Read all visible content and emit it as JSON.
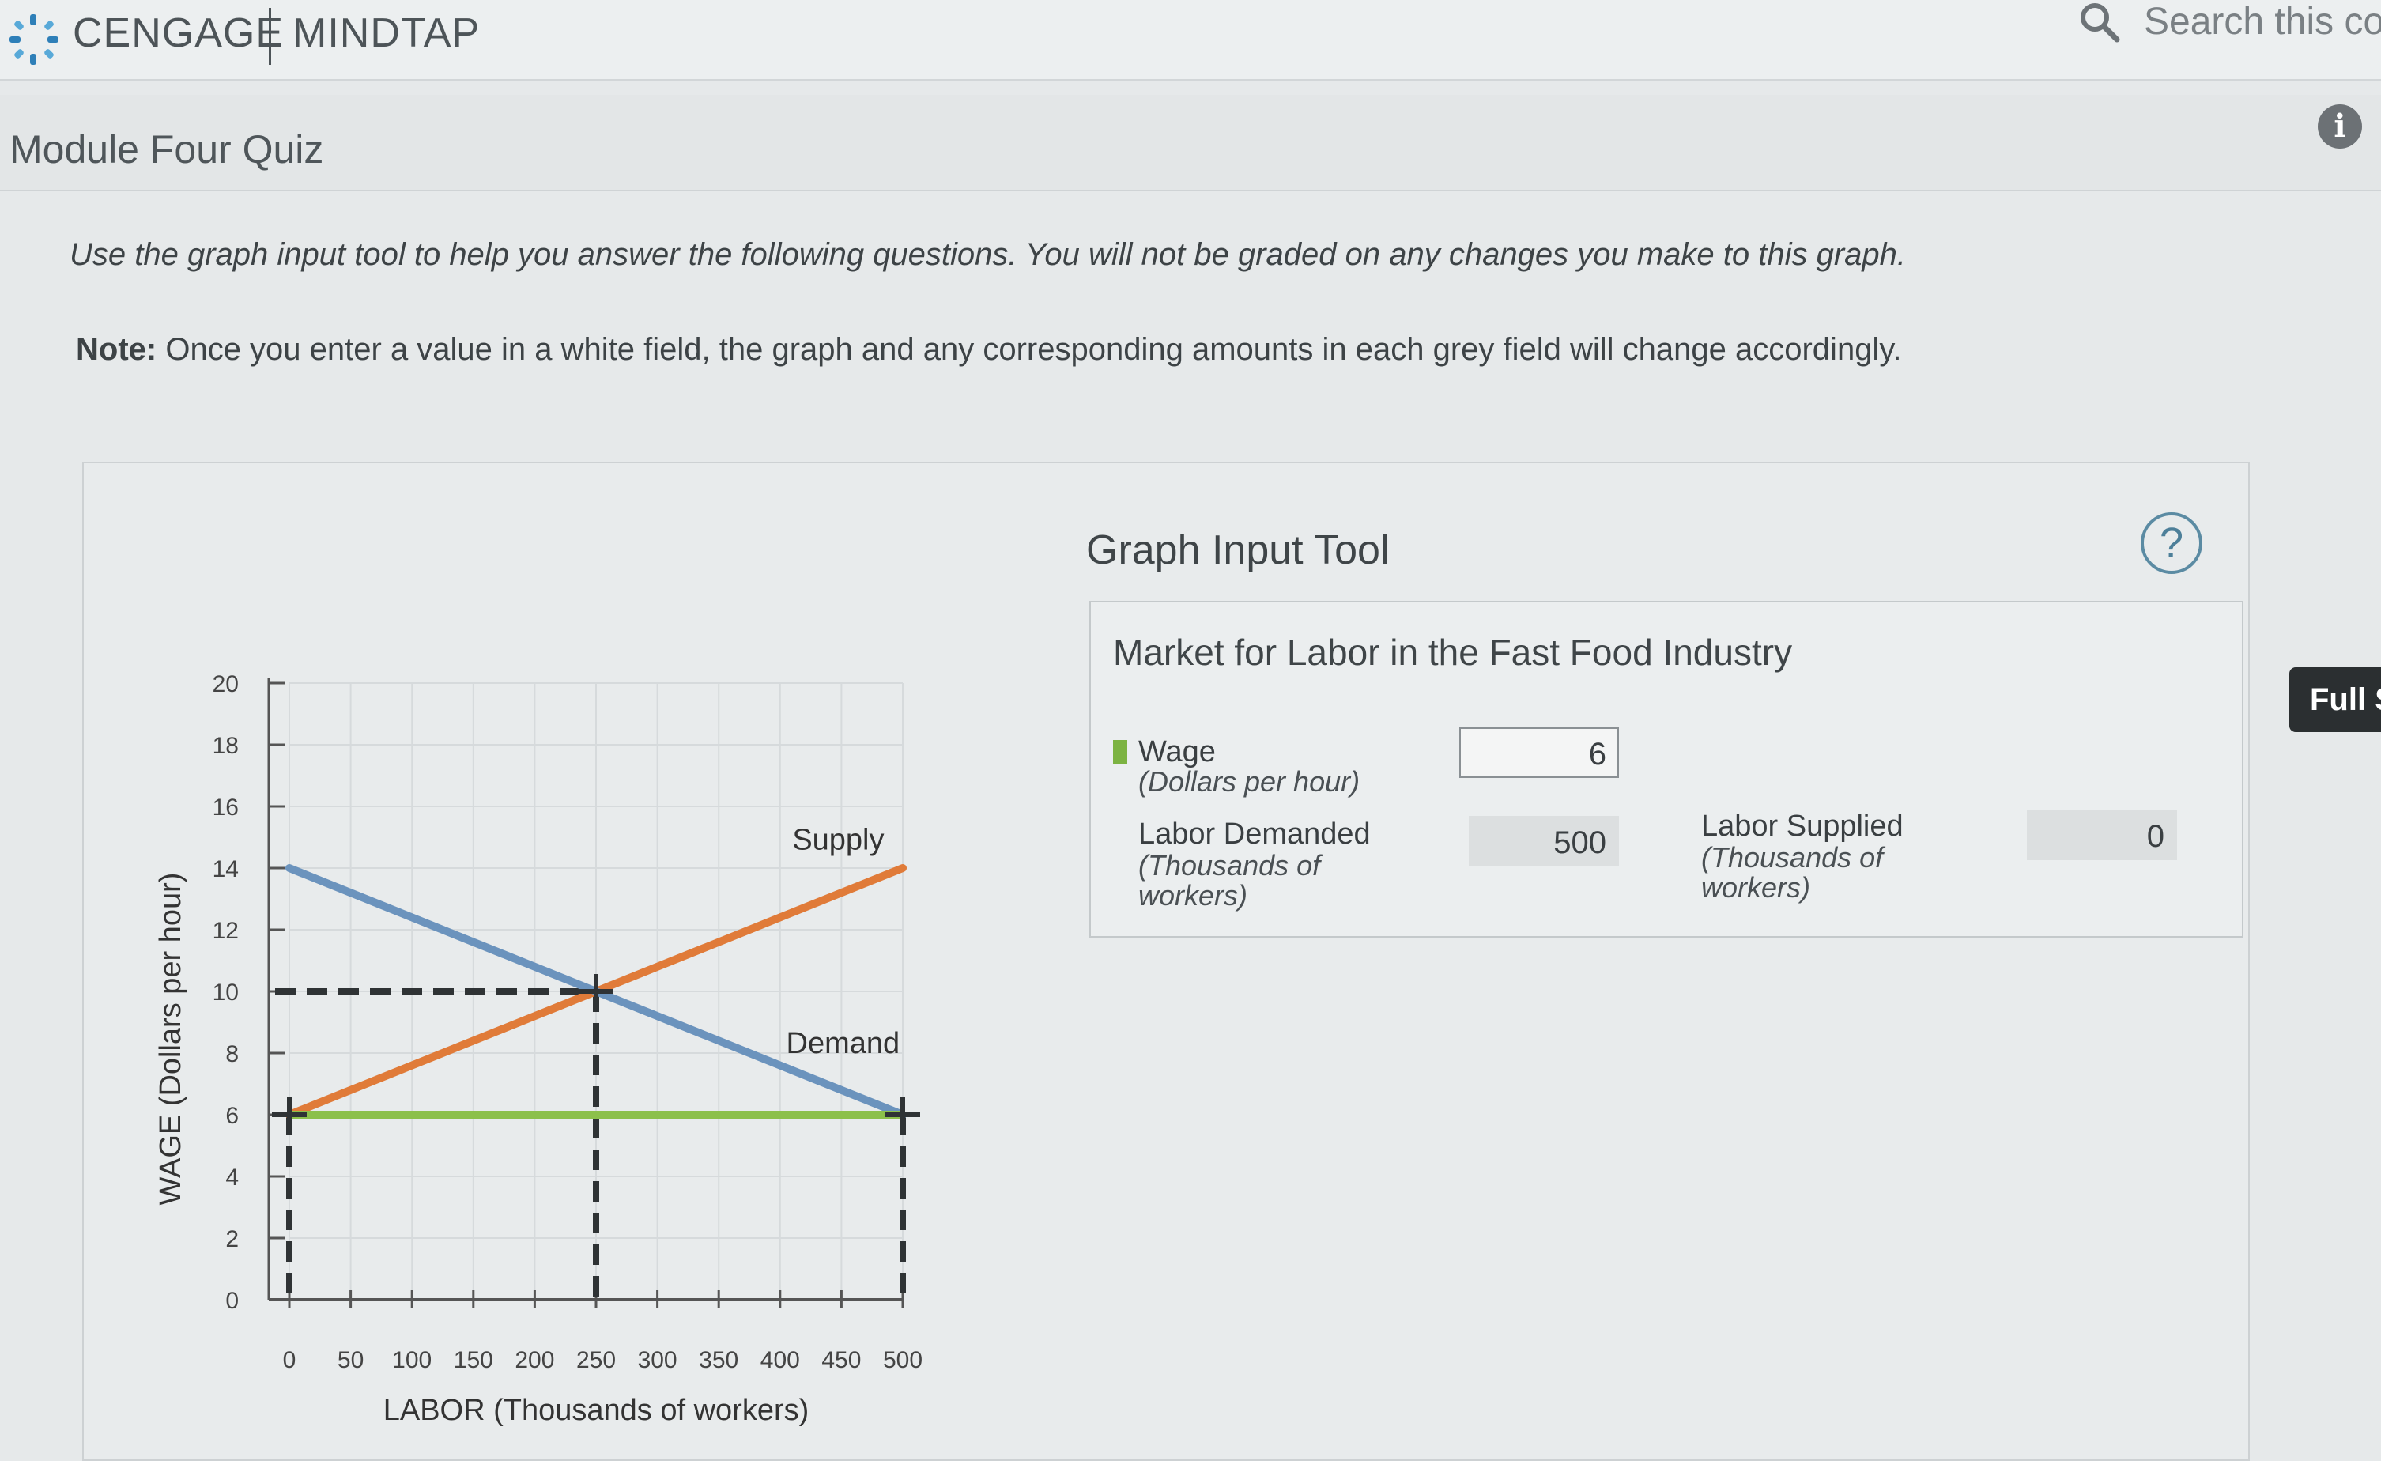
{
  "header": {
    "brand": "CENGAGE",
    "product": "MINDTAP",
    "search_placeholder": "Search this cou"
  },
  "page": {
    "title": "Module Four Quiz"
  },
  "instructions": {
    "text": "Use the graph input tool to help you answer the following questions. You will not be graded on any changes you make to this graph.",
    "note_label": "Note:",
    "note_text": " Once you enter a value in a white field, the graph and any corresponding amounts in each grey field will change accordingly."
  },
  "tool": {
    "title": "Graph Input Tool",
    "help": "?",
    "table_title": "Market for Labor in the Fast Food Industry",
    "wage_label": "Wage",
    "wage_unit": "(Dollars per hour)",
    "wage_value": "6",
    "demanded_label": "Labor Demanded",
    "demanded_unit_1": "(Thousands of",
    "demanded_unit_2": "workers)",
    "demanded_value": "500",
    "supplied_label": "Labor Supplied",
    "supplied_unit_1": "(Thousands of",
    "supplied_unit_2": "workers)",
    "supplied_value": "0",
    "wage_color": "#7cb342"
  },
  "side": {
    "full_label": "Full S"
  },
  "chart_data": {
    "type": "line",
    "xlabel": "LABOR (Thousands of workers)",
    "ylabel": "WAGE (Dollars per hour)",
    "x_ticks": [
      0,
      50,
      100,
      150,
      200,
      250,
      300,
      350,
      400,
      450,
      500
    ],
    "y_ticks": [
      0,
      2,
      4,
      6,
      8,
      10,
      12,
      14,
      16,
      18,
      20
    ],
    "xlim": [
      0,
      500
    ],
    "ylim": [
      0,
      20
    ],
    "series": [
      {
        "name": "Supply",
        "color": "#e07b39",
        "points": [
          [
            0,
            6
          ],
          [
            500,
            14
          ]
        ]
      },
      {
        "name": "Demand",
        "color": "#6b93bd",
        "points": [
          [
            0,
            14
          ],
          [
            500,
            6
          ]
        ]
      }
    ],
    "wage_line": {
      "y": 6,
      "color": "#8cc04b"
    },
    "equilibrium": {
      "x": 250,
      "y": 10
    },
    "guide_x": [
      0,
      250,
      500
    ],
    "guide_y": [
      10
    ]
  }
}
